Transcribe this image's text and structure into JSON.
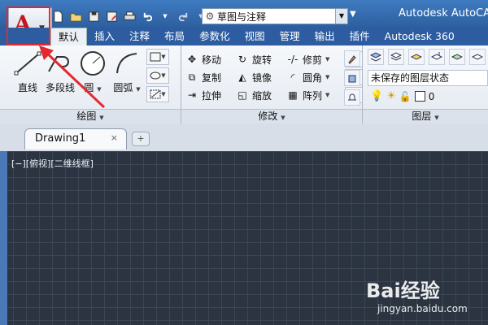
{
  "app": {
    "title": "Autodesk AutoCAD"
  },
  "quick_access": {
    "workspace": "草图与注释"
  },
  "ribbon": {
    "tabs": [
      "默认",
      "插入",
      "注释",
      "布局",
      "参数化",
      "视图",
      "管理",
      "输出",
      "插件",
      "Autodesk 360"
    ],
    "active_tab": "默认",
    "panels": {
      "draw": {
        "title": "绘图",
        "tools": [
          "直线",
          "多段线",
          "圆",
          "圆弧"
        ]
      },
      "modify": {
        "title": "修改",
        "rows": [
          [
            "移动",
            "旋转",
            "修剪"
          ],
          [
            "复制",
            "镜像",
            "圆角"
          ],
          [
            "拉伸",
            "缩放",
            "阵列"
          ]
        ]
      },
      "layers": {
        "title": "图层",
        "state": "未保存的图层状态",
        "current_layer": "0"
      }
    }
  },
  "document": {
    "tab_name": "Drawing1",
    "close_glyph": "×"
  },
  "viewport": {
    "label": "[−][俯视][二维线框]"
  },
  "watermark": {
    "brand": "Bai经验",
    "url": "jingyan.baidu.com"
  },
  "colors": {
    "title_bar": "#2c5f9f",
    "canvas": "#2b3440",
    "highlight": "#e3282e",
    "logo": "#c4161c"
  }
}
